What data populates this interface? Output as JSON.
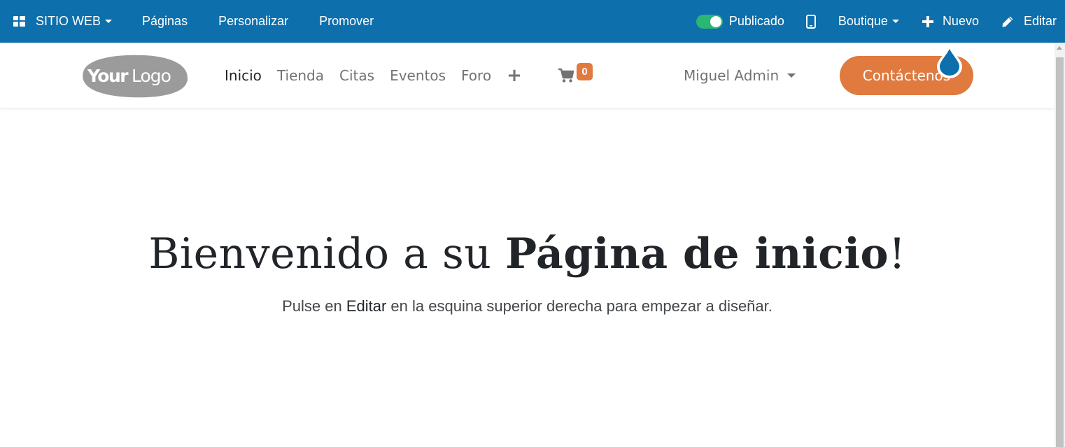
{
  "adminbar": {
    "apps_menu_label": "SITIO WEB",
    "pages_label": "Páginas",
    "customize_label": "Personalizar",
    "promote_label": "Promover",
    "published_label": "Publicado",
    "website_switch_label": "Boutique",
    "new_label": "Nuevo",
    "edit_label": "Editar",
    "bg_color": "#0d6fab"
  },
  "header": {
    "logo_text_bold": "Your",
    "logo_text_light": "Logo",
    "nav": [
      "Inicio",
      "Tienda",
      "Citas",
      "Eventos",
      "Foro"
    ],
    "add_menu_symbol": "+",
    "cart_count": "0",
    "user_name": "Miguel Admin",
    "cta_label": "Contáctenos",
    "accent_color": "#e07a3f"
  },
  "hero": {
    "title_part1": "Bienvenido a su ",
    "title_bold": "Página de inicio",
    "title_end": "!",
    "sub_part1": "Pulse en ",
    "sub_em": "Editar",
    "sub_part2": " en la esquina superior derecha para empezar a diseñar."
  }
}
